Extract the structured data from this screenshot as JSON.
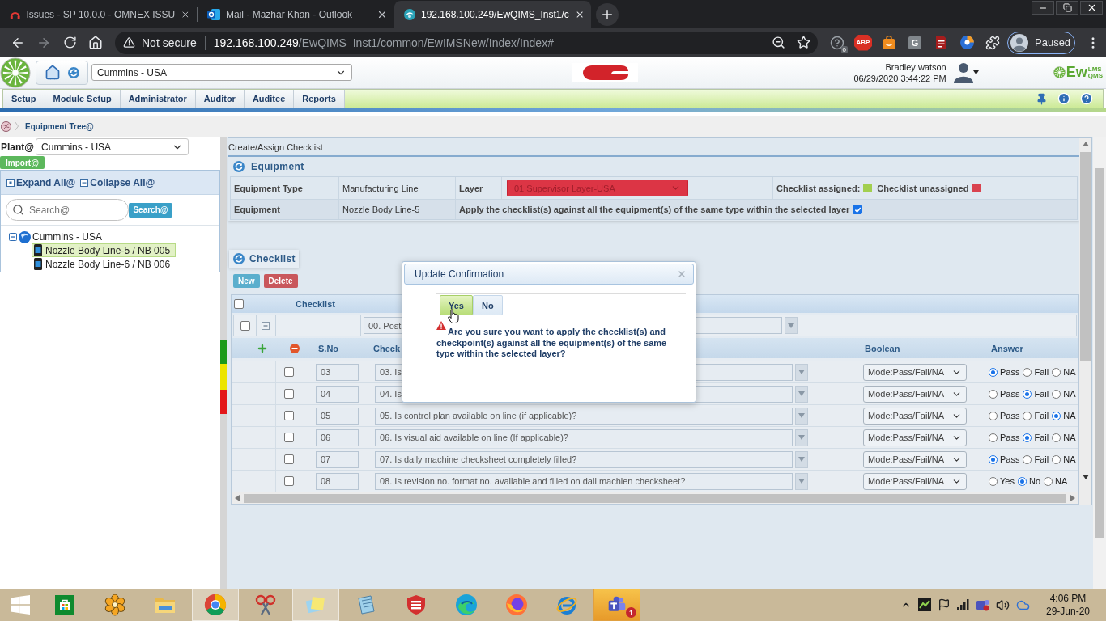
{
  "browser": {
    "tabs": [
      {
        "kind": "issues",
        "title": "Issues - SP 10.0.0 - OMNEX ISSU",
        "selected": false
      },
      {
        "kind": "mail",
        "title": "Mail - Mazhar Khan - Outlook",
        "selected": false
      },
      {
        "kind": "site",
        "title": "192.168.100.249/EwQIMS_Inst1/c",
        "selected": true
      }
    ],
    "security_label": "Not secure",
    "url_host": "192.168.100.249",
    "url_path": "/EwQIMS_Inst1/common/EwIMSNew/Index/Index#",
    "extensions": [
      {
        "kind": "help",
        "badge": "0"
      },
      {
        "kind": "abp",
        "label": "ABP"
      },
      {
        "kind": "bag"
      },
      {
        "kind": "letter",
        "label": "G"
      },
      {
        "kind": "doc"
      },
      {
        "kind": "ball"
      },
      {
        "kind": "puzzle"
      }
    ],
    "profile_status": "Paused"
  },
  "header": {
    "site_select": "Cummins - USA",
    "user_name": "Bradley watson",
    "datetime": "06/29/2020 3:44:22 PM",
    "logo": {
      "main": "Ew",
      "top": "LMS",
      "bottom": "QMS"
    }
  },
  "menu": [
    {
      "label": "Setup"
    },
    {
      "label": "Module Setup"
    },
    {
      "label": "Administrator"
    },
    {
      "label": "Auditor"
    },
    {
      "label": "Auditee"
    },
    {
      "label": "Reports"
    }
  ],
  "breadcrumb": "Equipment Tree@",
  "sidebar": {
    "plant_label": "Plant@",
    "plant_value": "Cummins - USA",
    "import_button": "Import@",
    "expand_all": "Expand All@",
    "collapse_all": "Collapse All@",
    "search_placeholder": "Search@",
    "search_button": "Search@",
    "tree": [
      {
        "label": "Cummins - USA",
        "expanded": true,
        "children": [
          {
            "label": "Nozzle Body Line-5 / NB 005",
            "selected": true
          },
          {
            "label": "Nozzle Body Line-6 / NB 006",
            "selected": false
          }
        ]
      }
    ]
  },
  "status_strip": [
    {
      "color": "#1c9a1c"
    },
    {
      "color": "#ece400"
    },
    {
      "color": "#e3171b"
    }
  ],
  "content": {
    "title": "Create/Assign Checklist",
    "equipment": {
      "heading": "Equipment",
      "type_label": "Equipment Type",
      "type_value": "Manufacturing Line",
      "layer_label": "Layer",
      "layer_value": "01 Supervisor Layer-USA",
      "legend": [
        {
          "label": "Checklist assigned:",
          "color": "#a2cf4f"
        },
        {
          "label": "Checklist unassigned",
          "color": "#d9434f"
        }
      ],
      "equipment_label": "Equipment",
      "equipment_value": "Nozzle Body Line-5",
      "apply_label": "Apply the checklist(s) against all the equipment(s) of the same type within the selected layer",
      "apply_checked": true
    },
    "checklist": {
      "heading": "Checklist",
      "buttons": [
        {
          "kind": "new",
          "label": "New"
        },
        {
          "kind": "delete",
          "label": "Delete"
        }
      ],
      "group_label": "Checklist",
      "group_checked": false,
      "filter_checked": false,
      "filter_expanded": true,
      "filter_value": "00. Post",
      "columns": [
        "S.No",
        "Check",
        "Boolean",
        "Answer"
      ],
      "rows": [
        {
          "checked": false,
          "sno": "03",
          "checkpoint": "03. Is",
          "mode": "Mode:Pass/Fail/NA",
          "options": [
            {
              "label": "Pass",
              "selected": true
            },
            {
              "label": "Fail",
              "selected": false
            },
            {
              "label": "NA",
              "selected": false
            }
          ]
        },
        {
          "checked": false,
          "sno": "04",
          "checkpoint": "04. Is",
          "mode": "Mode:Pass/Fail/NA",
          "options": [
            {
              "label": "Pass",
              "selected": false
            },
            {
              "label": "Fail",
              "selected": true
            },
            {
              "label": "NA",
              "selected": false
            }
          ]
        },
        {
          "checked": false,
          "sno": "05",
          "checkpoint": "05. Is control plan available on line (if applicable)?",
          "mode": "Mode:Pass/Fail/NA",
          "options": [
            {
              "label": "Pass",
              "selected": false
            },
            {
              "label": "Fail",
              "selected": false
            },
            {
              "label": "NA",
              "selected": true
            }
          ]
        },
        {
          "checked": false,
          "sno": "06",
          "checkpoint": "06. Is visual aid available on line (If applicable)?",
          "mode": "Mode:Pass/Fail/NA",
          "options": [
            {
              "label": "Pass",
              "selected": false
            },
            {
              "label": "Fail",
              "selected": true
            },
            {
              "label": "NA",
              "selected": false
            }
          ]
        },
        {
          "checked": false,
          "sno": "07",
          "checkpoint": "07. Is daily machine checksheet completely filled?",
          "mode": "Mode:Pass/Fail/NA",
          "options": [
            {
              "label": "Pass",
              "selected": true
            },
            {
              "label": "Fail",
              "selected": false
            },
            {
              "label": "NA",
              "selected": false
            }
          ]
        },
        {
          "checked": false,
          "sno": "08",
          "checkpoint": "08. Is revision no. format no. available and filled on dail machien checksheet?",
          "mode": "Mode:Pass/Fail/NA",
          "options": [
            {
              "label": "Yes",
              "selected": false
            },
            {
              "label": "No",
              "selected": true
            },
            {
              "label": "NA",
              "selected": false
            }
          ]
        }
      ]
    }
  },
  "dialog": {
    "title": "Update Confirmation",
    "buttons": [
      {
        "label": "Yes",
        "hovered": true
      },
      {
        "label": "No",
        "hovered": false
      }
    ],
    "message": "Are you sure you want to apply the checklist(s) and checkpoint(s) against all the equipment(s) of the same type within the selected layer?"
  },
  "taskbar": {
    "apps": [
      {
        "kind": "store",
        "open": false,
        "alert": false
      },
      {
        "kind": "flower",
        "open": false,
        "alert": false
      },
      {
        "kind": "folder",
        "open": false,
        "alert": false
      },
      {
        "kind": "chrome",
        "open": true,
        "alert": false
      },
      {
        "kind": "scissors",
        "open": false,
        "alert": false
      },
      {
        "kind": "notes",
        "open": true,
        "alert": false
      },
      {
        "kind": "notepad",
        "open": false,
        "alert": false
      },
      {
        "kind": "shield",
        "open": false,
        "alert": false
      },
      {
        "kind": "edge",
        "open": false,
        "alert": false
      },
      {
        "kind": "firefox",
        "open": false,
        "alert": false
      },
      {
        "kind": "ie",
        "open": false,
        "alert": false
      },
      {
        "kind": "teams",
        "open": true,
        "alert": true,
        "badge": "1"
      }
    ],
    "time": "4:06 PM",
    "date": "29-Jun-20"
  }
}
